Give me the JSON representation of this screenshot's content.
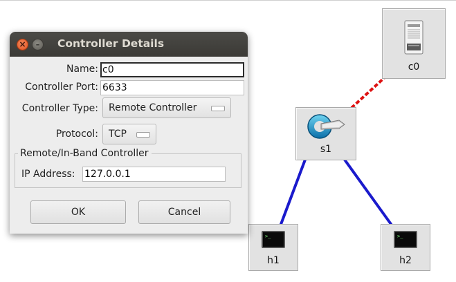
{
  "dialog": {
    "title": "Controller Details",
    "fields": {
      "name_label": "Name:",
      "name_value": "c0",
      "port_label": "Controller Port:",
      "port_value": "6633",
      "type_label": "Controller Type:",
      "type_value": "Remote Controller",
      "protocol_label": "Protocol:",
      "protocol_value": "TCP"
    },
    "group": {
      "legend": "Remote/In-Band Controller",
      "ip_label": "IP Address:",
      "ip_value": "127.0.0.1"
    },
    "buttons": {
      "ok": "OK",
      "cancel": "Cancel"
    }
  },
  "topology": {
    "nodes": {
      "controller": "c0",
      "switch": "s1",
      "host1": "h1",
      "host2": "h2"
    },
    "terminal_prompt": ">_"
  },
  "colors": {
    "controller_link": "#dd1111",
    "host_link": "#1a1acc",
    "titlebar": "#3e3d39"
  }
}
